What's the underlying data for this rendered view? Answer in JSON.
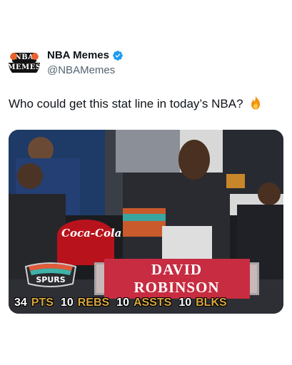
{
  "tweet": {
    "display_name": "NBA Memes",
    "handle": "@NBAMemes",
    "text": "Who could get this stat line in today’s NBA?",
    "avatar_logo_top": "NBA",
    "avatar_logo_bottom": "MEMES"
  },
  "media": {
    "cup_brand": "Coca-Cola",
    "team_logo_text": "SPURS",
    "player_name": "DAVID ROBINSON",
    "stats": [
      {
        "value": "34",
        "label": "PTS"
      },
      {
        "value": "10",
        "label": "REBS"
      },
      {
        "value": "10",
        "label": "ASSTS"
      },
      {
        "value": "10",
        "label": "BLKS"
      }
    ]
  },
  "colors": {
    "verified": "#1d9bf0",
    "banner_red": "#c72c41",
    "stat_label": "#d9a640",
    "handle_gray": "#536471"
  },
  "icons": [
    "verified-badge-icon",
    "fire-emoji-icon",
    "avatar-logo"
  ]
}
